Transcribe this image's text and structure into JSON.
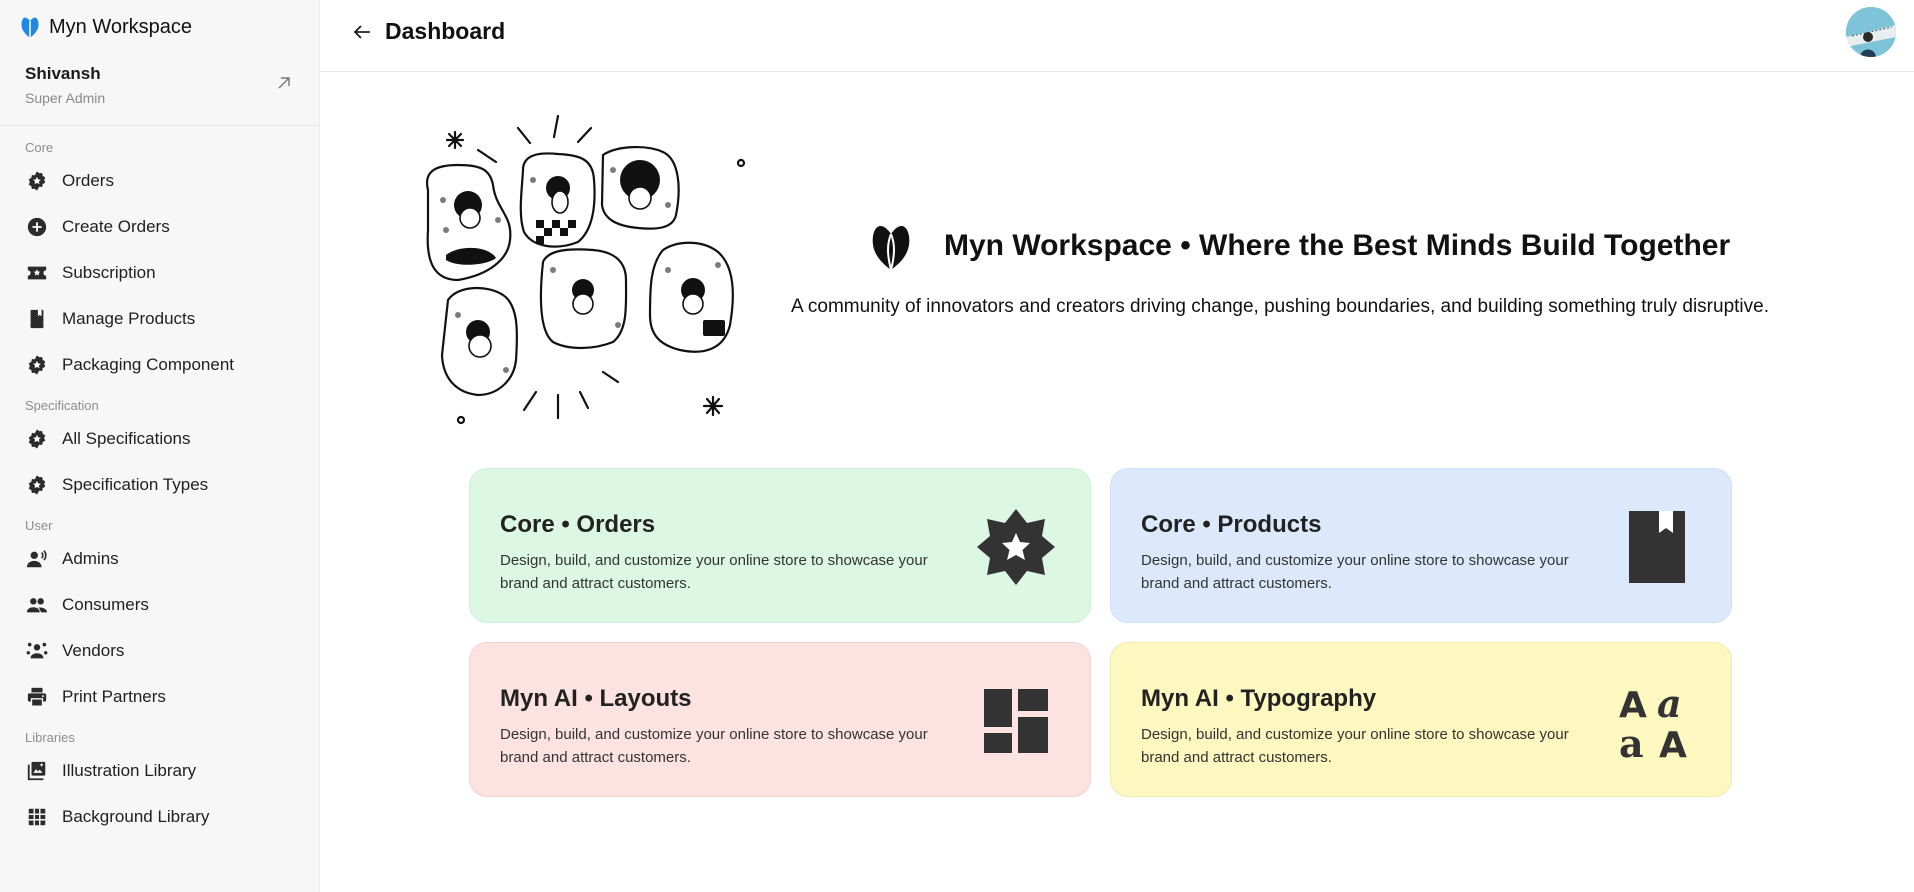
{
  "brand": {
    "name": "Myn Workspace",
    "accent": "#1e88e5"
  },
  "user": {
    "name": "Shivansh",
    "role": "Super Admin"
  },
  "sidebar": {
    "sections": [
      {
        "label": "Core",
        "items": [
          {
            "label": "Orders",
            "icon": "gear-badge-icon"
          },
          {
            "label": "Create Orders",
            "icon": "plus-circle-icon"
          },
          {
            "label": "Subscription",
            "icon": "ticket-icon"
          },
          {
            "label": "Manage Products",
            "icon": "bookmark-icon"
          },
          {
            "label": "Packaging Component",
            "icon": "gear-badge-icon"
          }
        ]
      },
      {
        "label": "Specification",
        "items": [
          {
            "label": "All Specifications",
            "icon": "gear-badge-icon"
          },
          {
            "label": "Specification Types",
            "icon": "gear-badge-icon"
          }
        ]
      },
      {
        "label": "User",
        "items": [
          {
            "label": "Admins",
            "icon": "admin-icon"
          },
          {
            "label": "Consumers",
            "icon": "group-icon"
          },
          {
            "label": "Vendors",
            "icon": "vendors-icon"
          },
          {
            "label": "Print Partners",
            "icon": "printer-icon"
          }
        ]
      },
      {
        "label": "Libraries",
        "items": [
          {
            "label": "Illustration Library",
            "icon": "illustration-icon"
          },
          {
            "label": "Background Library",
            "icon": "grid-icon"
          }
        ]
      }
    ]
  },
  "header": {
    "title": "Dashboard"
  },
  "hero": {
    "title": "Myn Workspace • Where the Best Minds Build Together",
    "subtitle": "A community of innovators and creators driving change, pushing boundaries, and building something truly disruptive."
  },
  "cards": [
    {
      "title": "Core • Orders",
      "desc": "Design, build, and customize your online store to showcase your brand and attract customers.",
      "icon": "star-badge-icon",
      "color": "#dcf7e3"
    },
    {
      "title": "Core • Products",
      "desc": "Design, build, and customize your online store to showcase your brand and attract customers.",
      "icon": "bookmark-icon",
      "color": "#dce9fc"
    },
    {
      "title": "Myn AI • Layouts",
      "desc": "Design, build, and customize your online store to showcase your brand and attract customers.",
      "icon": "layout-icon",
      "color": "#fde2e2"
    },
    {
      "title": "Myn AI • Typography",
      "desc": "Design, build, and customize your online store to showcase your brand and attract customers.",
      "icon": "typography-icon",
      "color": "#fdf7c0"
    }
  ]
}
